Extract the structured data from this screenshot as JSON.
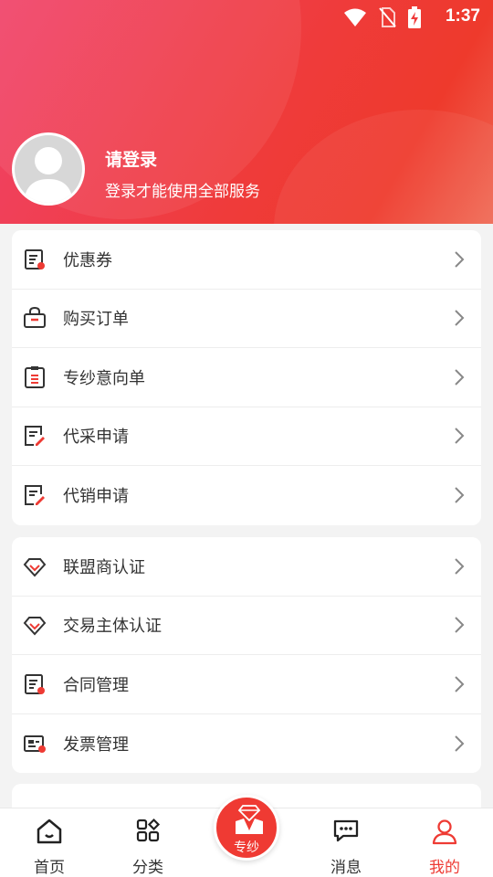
{
  "status_bar": {
    "time": "1:37"
  },
  "profile": {
    "title": "请登录",
    "subtitle": "登录才能使用全部服务"
  },
  "section1": [
    {
      "label": "优惠券",
      "icon": "coupon-icon"
    },
    {
      "label": "购买订单",
      "icon": "bag-icon"
    },
    {
      "label": "专纱意向单",
      "icon": "clipboard-icon"
    },
    {
      "label": "代采申请",
      "icon": "edit-doc-icon"
    },
    {
      "label": "代销申请",
      "icon": "edit-doc-icon"
    }
  ],
  "section2": [
    {
      "label": "联盟商认证",
      "icon": "diamond-icon"
    },
    {
      "label": "交易主体认证",
      "icon": "diamond-icon"
    },
    {
      "label": "合同管理",
      "icon": "contract-icon"
    },
    {
      "label": "发票管理",
      "icon": "invoice-icon"
    }
  ],
  "tabbar": {
    "home": "首页",
    "category": "分类",
    "center": "专纱",
    "messages": "消息",
    "mine": "我的"
  },
  "colors": {
    "accent": "#ee3b34",
    "header_start": "#f0436a",
    "header_end": "#ee3a2c"
  }
}
